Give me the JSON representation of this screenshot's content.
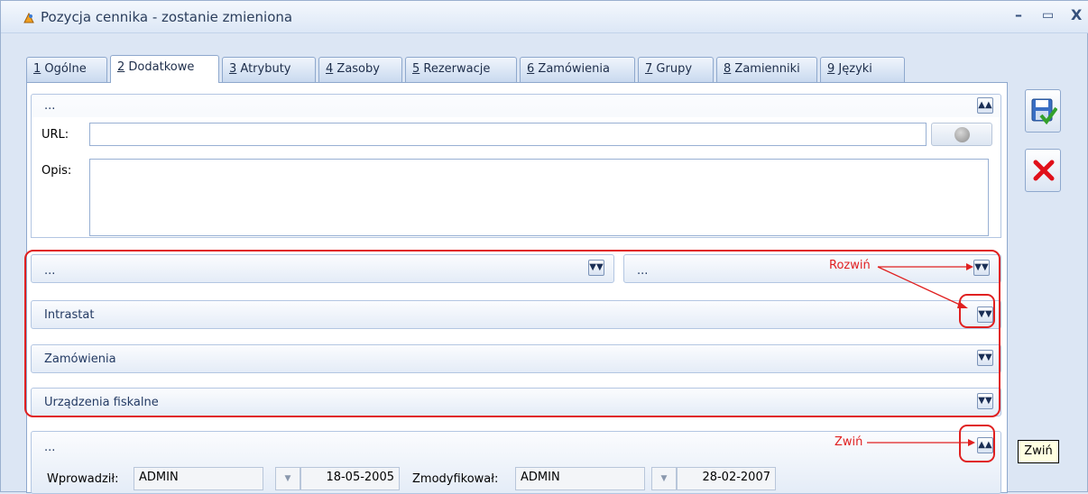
{
  "window": {
    "title": "Pozycja cennika - zostanie zmieniona",
    "minimize": "–",
    "maximize": "▭",
    "close": "X"
  },
  "tabs": [
    {
      "num": "1",
      "label": " Ogólne"
    },
    {
      "num": "2",
      "label": " Dodatkowe"
    },
    {
      "num": "3",
      "label": " Atrybuty"
    },
    {
      "num": "4",
      "label": " Zasoby"
    },
    {
      "num": "5",
      "label": " Rezerwacje"
    },
    {
      "num": "6",
      "label": " Zamówienia"
    },
    {
      "num": "7",
      "label": " Grupy"
    },
    {
      "num": "8",
      "label": " Zamienniki"
    },
    {
      "num": "9",
      "label": " Języki"
    }
  ],
  "active_tab": "2 Dodatkowe",
  "top_panel": {
    "header": "...",
    "url_label": "URL:",
    "url_value": "",
    "opis_label": "Opis:",
    "opis_value": ""
  },
  "collapsed_panels": {
    "left_header": "...",
    "right_header": "...",
    "intrastat": "Intrastat",
    "zamowienia": "Zamówienia",
    "urzadzenia": "Urządzenia fiskalne"
  },
  "annotations": {
    "expand": "Rozwiń",
    "collapse": "Zwiń"
  },
  "bottom_panel": {
    "header": "...",
    "wprowadzil_label": "Wprowadził:",
    "wprowadzil_value": "ADMIN",
    "wprowadzil_date": "18-05-2005",
    "zmodyfikowal_label": "Zmodyfikował:",
    "zmodyfikowal_value": "ADMIN",
    "zmodyfikowal_date": "28-02-2007"
  },
  "tooltip": "Zwiń",
  "icons": {
    "expand": "double-chevron-down",
    "collapse": "double-chevron-up",
    "save": "floppy-disk-check",
    "cancel": "red-x",
    "globe": "globe"
  },
  "colors": {
    "annotation_red": "#e02020",
    "panel_border": "#b3c6e2",
    "tab_border": "#8ea8cd"
  }
}
